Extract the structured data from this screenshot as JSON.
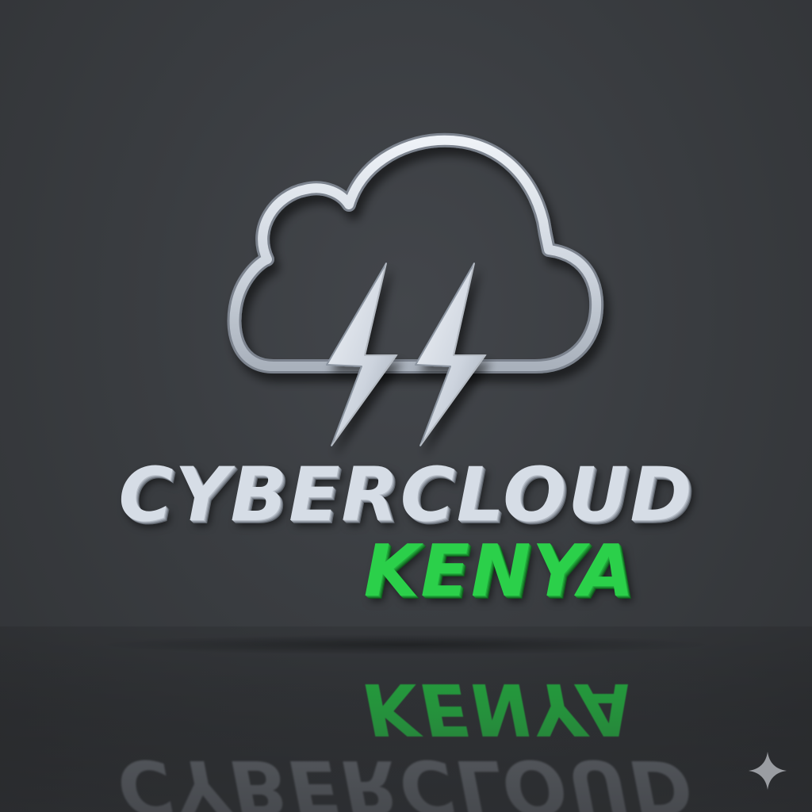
{
  "brand": {
    "name": "CYBERCLOUD",
    "region": "KENYA"
  },
  "colors": {
    "background": "#3a3d41",
    "metal": "#d6dde6",
    "accent_green": "#2bd04a"
  },
  "icons": {
    "emblem": "cloud-with-two-lightning-bolts",
    "corner_mark": "four-point-sparkle"
  }
}
